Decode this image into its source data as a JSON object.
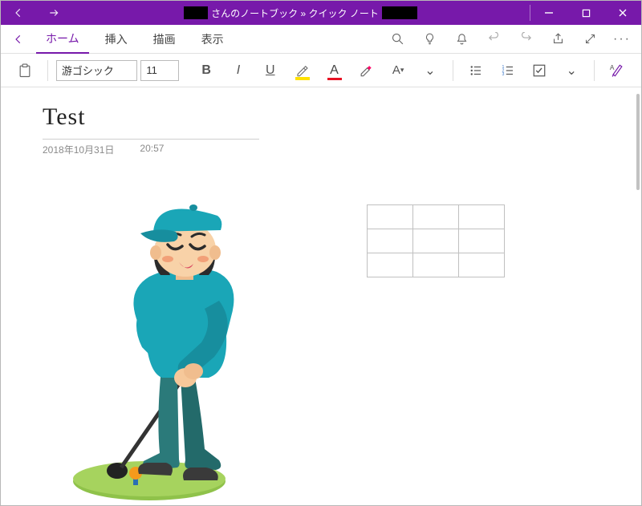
{
  "window": {
    "title_middle": "さんのノートブック » クイック ノート"
  },
  "tabs": {
    "home": "ホーム",
    "insert": "挿入",
    "draw": "描画",
    "view": "表示"
  },
  "toolbar": {
    "font_name": "游ゴシック",
    "font_size": "11",
    "bold": "B",
    "italic": "I",
    "underline": "U",
    "font_letter": "A"
  },
  "note": {
    "title": "Test",
    "date": "2018年10月31日",
    "time": "20:57"
  },
  "table": {
    "rows": 3,
    "cols": 3
  },
  "image": {
    "desc": "golfer-clipart"
  }
}
